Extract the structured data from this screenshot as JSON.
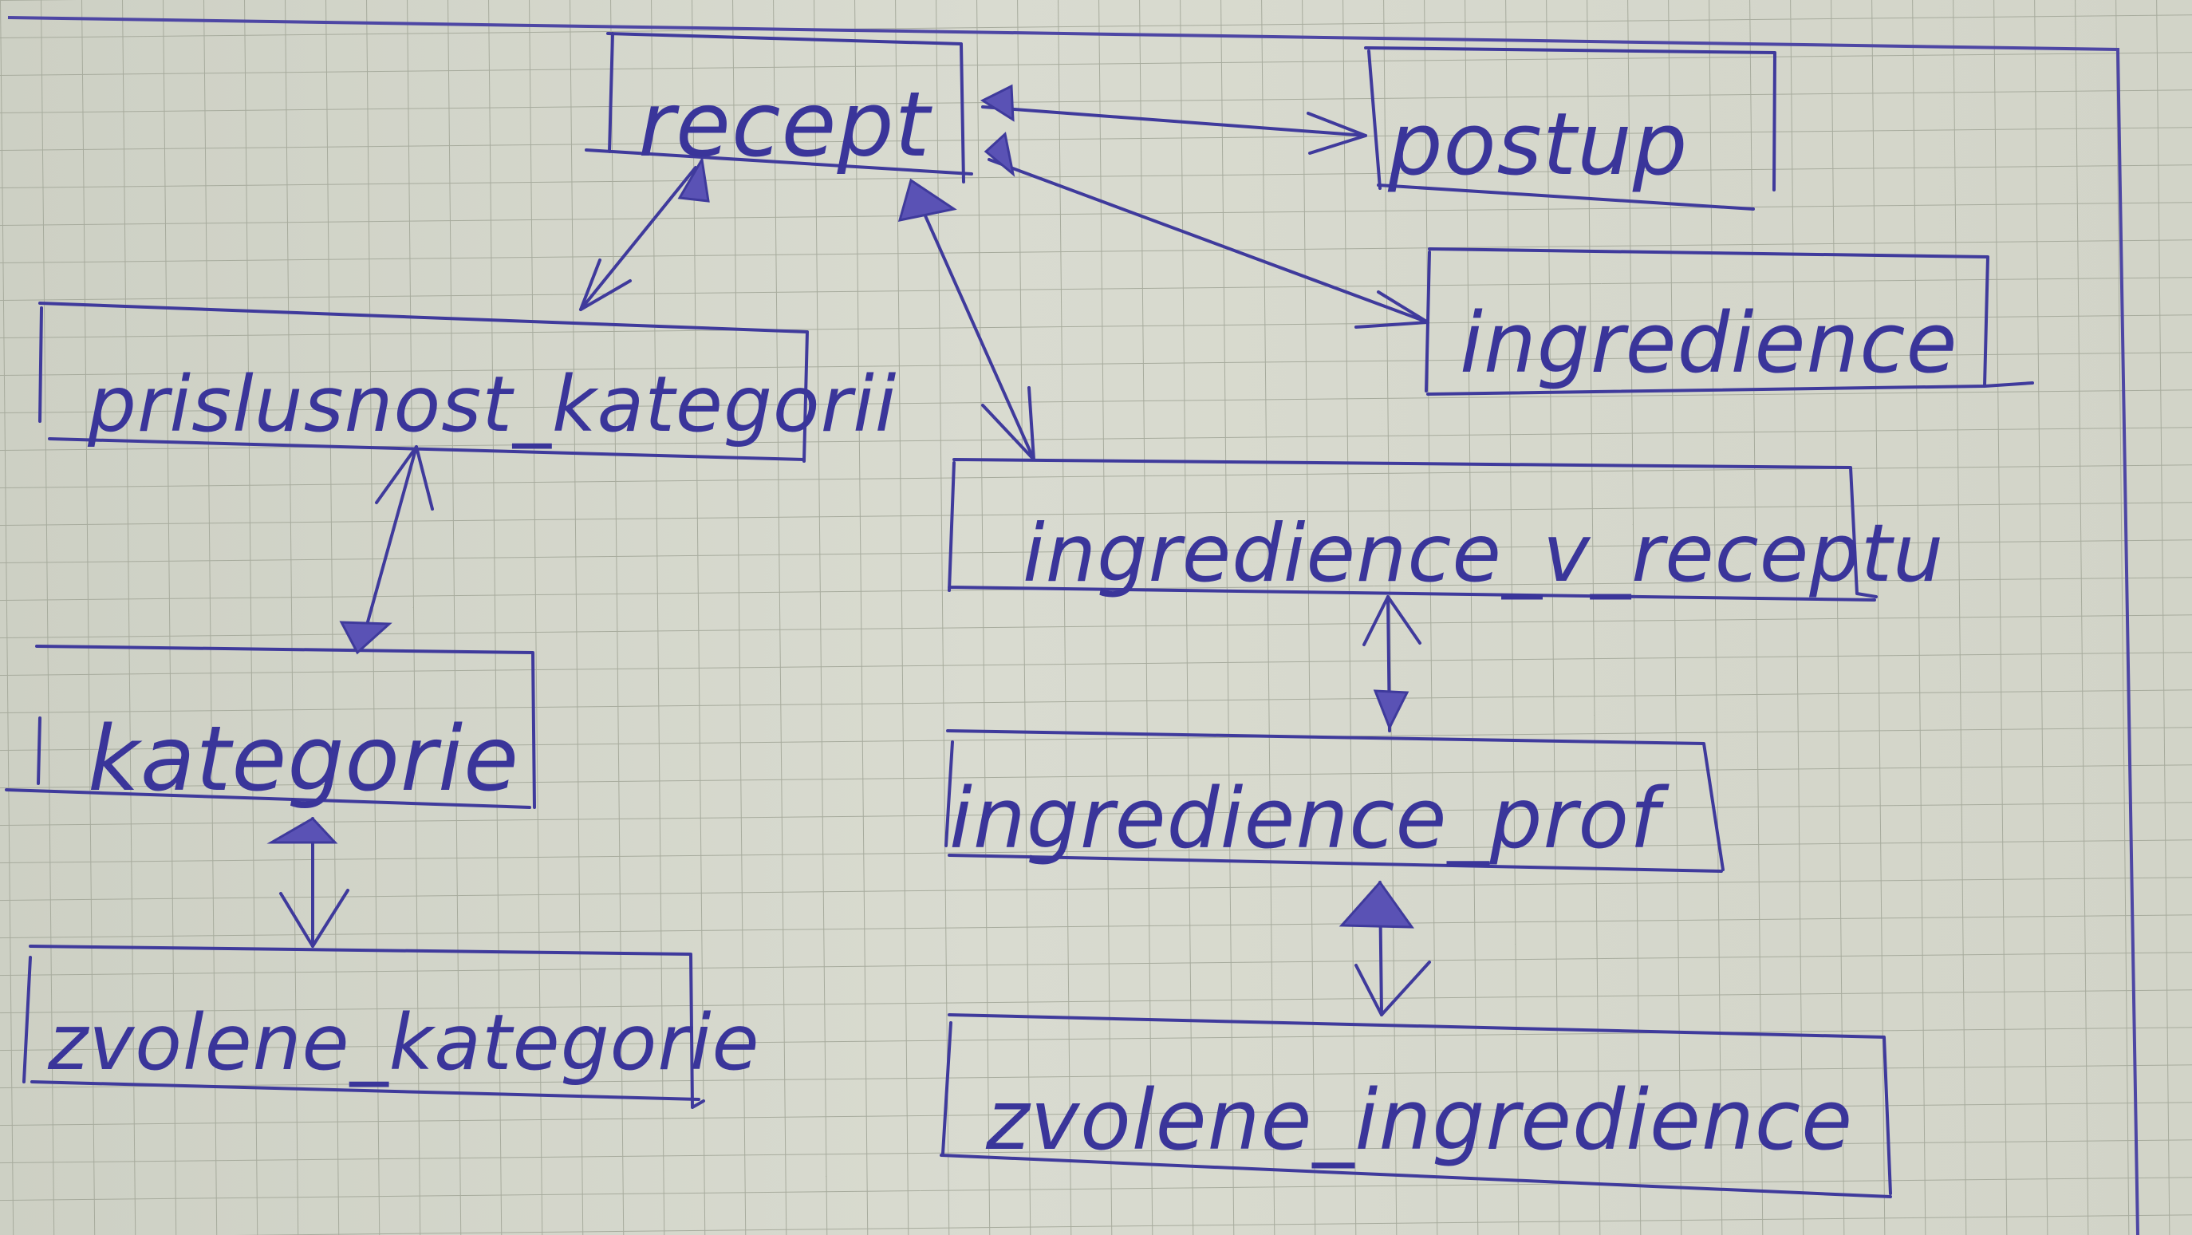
{
  "diagram": {
    "entities": {
      "recept": "recept",
      "postup": "postup",
      "ingredience": "ingredience",
      "prislusnost_kategorii": "prislusnost_kategorii",
      "ingredience_v_receptu": "ingredience_v_receptu",
      "kategorie": "kategorie",
      "ingredience_prof": "ingredience_prof",
      "zvolene_kategorie": "zvolene_kategorie",
      "zvolene_ingredience": "zvolene_ingredience"
    },
    "relationships": [
      {
        "from": "recept",
        "to": "postup",
        "from_end": "one",
        "to_end": "many"
      },
      {
        "from": "recept",
        "to": "ingredience",
        "from_end": "one",
        "to_end": "many"
      },
      {
        "from": "recept",
        "to": "prislusnost_kategorii",
        "from_end": "one",
        "to_end": "many"
      },
      {
        "from": "recept",
        "to": "ingredience_v_receptu",
        "from_end": "one",
        "to_end": "many"
      },
      {
        "from": "prislusnost_kategorii",
        "to": "kategorie",
        "from_end": "many",
        "to_end": "one"
      },
      {
        "from": "ingredience_v_receptu",
        "to": "ingredience_prof",
        "from_end": "many",
        "to_end": "one"
      },
      {
        "from": "kategorie",
        "to": "zvolene_kategorie",
        "from_end": "one",
        "to_end": "many"
      },
      {
        "from": "ingredience_prof",
        "to": "zvolene_ingredience",
        "from_end": "one",
        "to_end": "many"
      }
    ],
    "colors": {
      "ink": "#3f3a9c",
      "paper": "#d9dbd0",
      "grid": "#a9ad9f"
    }
  }
}
